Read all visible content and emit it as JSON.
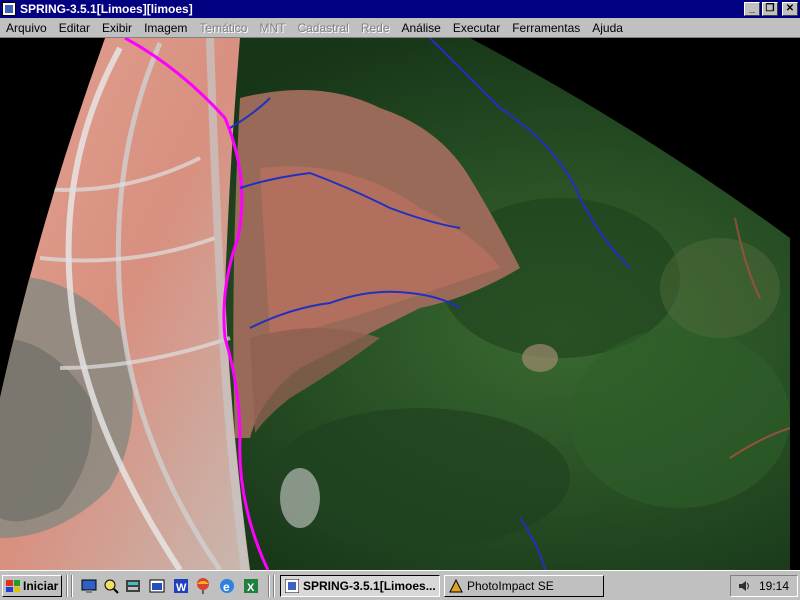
{
  "window": {
    "title": "SPRING-3.5.1[Limoes][limoes]",
    "minimize_label": "_",
    "maximize_label": "❐",
    "close_label": "✕"
  },
  "menu": {
    "items": [
      {
        "label": "Arquivo",
        "enabled": true
      },
      {
        "label": "Editar",
        "enabled": true
      },
      {
        "label": "Exibir",
        "enabled": true
      },
      {
        "label": "Imagem",
        "enabled": true
      },
      {
        "label": "Temático",
        "enabled": false
      },
      {
        "label": "MNT",
        "enabled": false
      },
      {
        "label": "Cadastral",
        "enabled": false
      },
      {
        "label": "Rede",
        "enabled": false
      },
      {
        "label": "Análise",
        "enabled": true
      },
      {
        "label": "Executar",
        "enabled": true
      },
      {
        "label": "Ferramentas",
        "enabled": true
      },
      {
        "label": "Ajuda",
        "enabled": true
      }
    ]
  },
  "map": {
    "content": "aerial-satellite-image",
    "colors": {
      "background": "#000000",
      "urban": "#b06850",
      "soil": "#d89080",
      "vegetation": "#2d5a28",
      "boundary_line": "#ff00ff",
      "drainage_lines": "#2030c0"
    }
  },
  "taskbar": {
    "start_label": "Iniciar",
    "quick_launch": [
      "desktop-icon",
      "explorer-icon",
      "calculator-icon",
      "app-icon",
      "word-icon",
      "balloon-icon",
      "internet-explorer-icon",
      "excel-icon"
    ],
    "tasks": [
      {
        "label": "SPRING-3.5.1[Limoes...",
        "active": true
      },
      {
        "label": "PhotoImpact SE",
        "active": false
      }
    ],
    "clock": "19:14"
  }
}
